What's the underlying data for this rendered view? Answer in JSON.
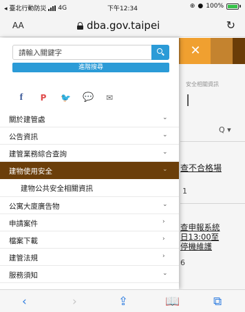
{
  "status_bar": {
    "carrier": "◂ 臺北行動防災",
    "network": "4G",
    "time": "下午12:34",
    "battery_percent": "100%",
    "battery_level": 1.0,
    "battery_color": "#36c24a"
  },
  "browser": {
    "text_size_label": "AA",
    "url": "dba.gov.taipei",
    "reload_icon": "reload-icon"
  },
  "menu": {
    "search_placeholder": "請輸入關鍵字",
    "advanced_search_label": "進階搜尋",
    "social_icons": [
      "facebook-icon",
      "plurk-icon",
      "twitter-icon",
      "line-icon",
      "email-icon"
    ],
    "items": [
      {
        "label": "關於建管處",
        "chevron": "⌄"
      },
      {
        "label": "公告資訊",
        "chevron": "⌄"
      },
      {
        "label": "建管業務綜合查詢",
        "chevron": "⌄"
      },
      {
        "label": "建物使用安全",
        "chevron": "⌄"
      },
      {
        "label": "建物公共安全相關資訊",
        "chevron": ""
      },
      {
        "label": "公寓大廈廣告物",
        "chevron": "⌄"
      },
      {
        "label": "申請案件",
        "chevron": "›"
      },
      {
        "label": "檔案下載",
        "chevron": "›"
      },
      {
        "label": "建管法規",
        "chevron": "›"
      },
      {
        "label": "服務須知",
        "chevron": "⌄"
      }
    ],
    "active_color": "#6b3e0a",
    "accent_color": "#2b9bd7"
  },
  "page_behind": {
    "close_label": "✕",
    "breadcrumb": "安全相關資訊",
    "big_char": "l",
    "search_icon_label": "Q ▾",
    "link_text": "查不合格場",
    "digit_1": "1",
    "notice_lines": [
      "查申報系統",
      "日13:00至",
      "停機維護"
    ],
    "digit_2": "6",
    "header_color": "#c4832f"
  },
  "toolbar": {
    "back": "‹",
    "forward": "›",
    "share": "⇪",
    "bookmarks": "📖",
    "tabs": "⧉"
  }
}
